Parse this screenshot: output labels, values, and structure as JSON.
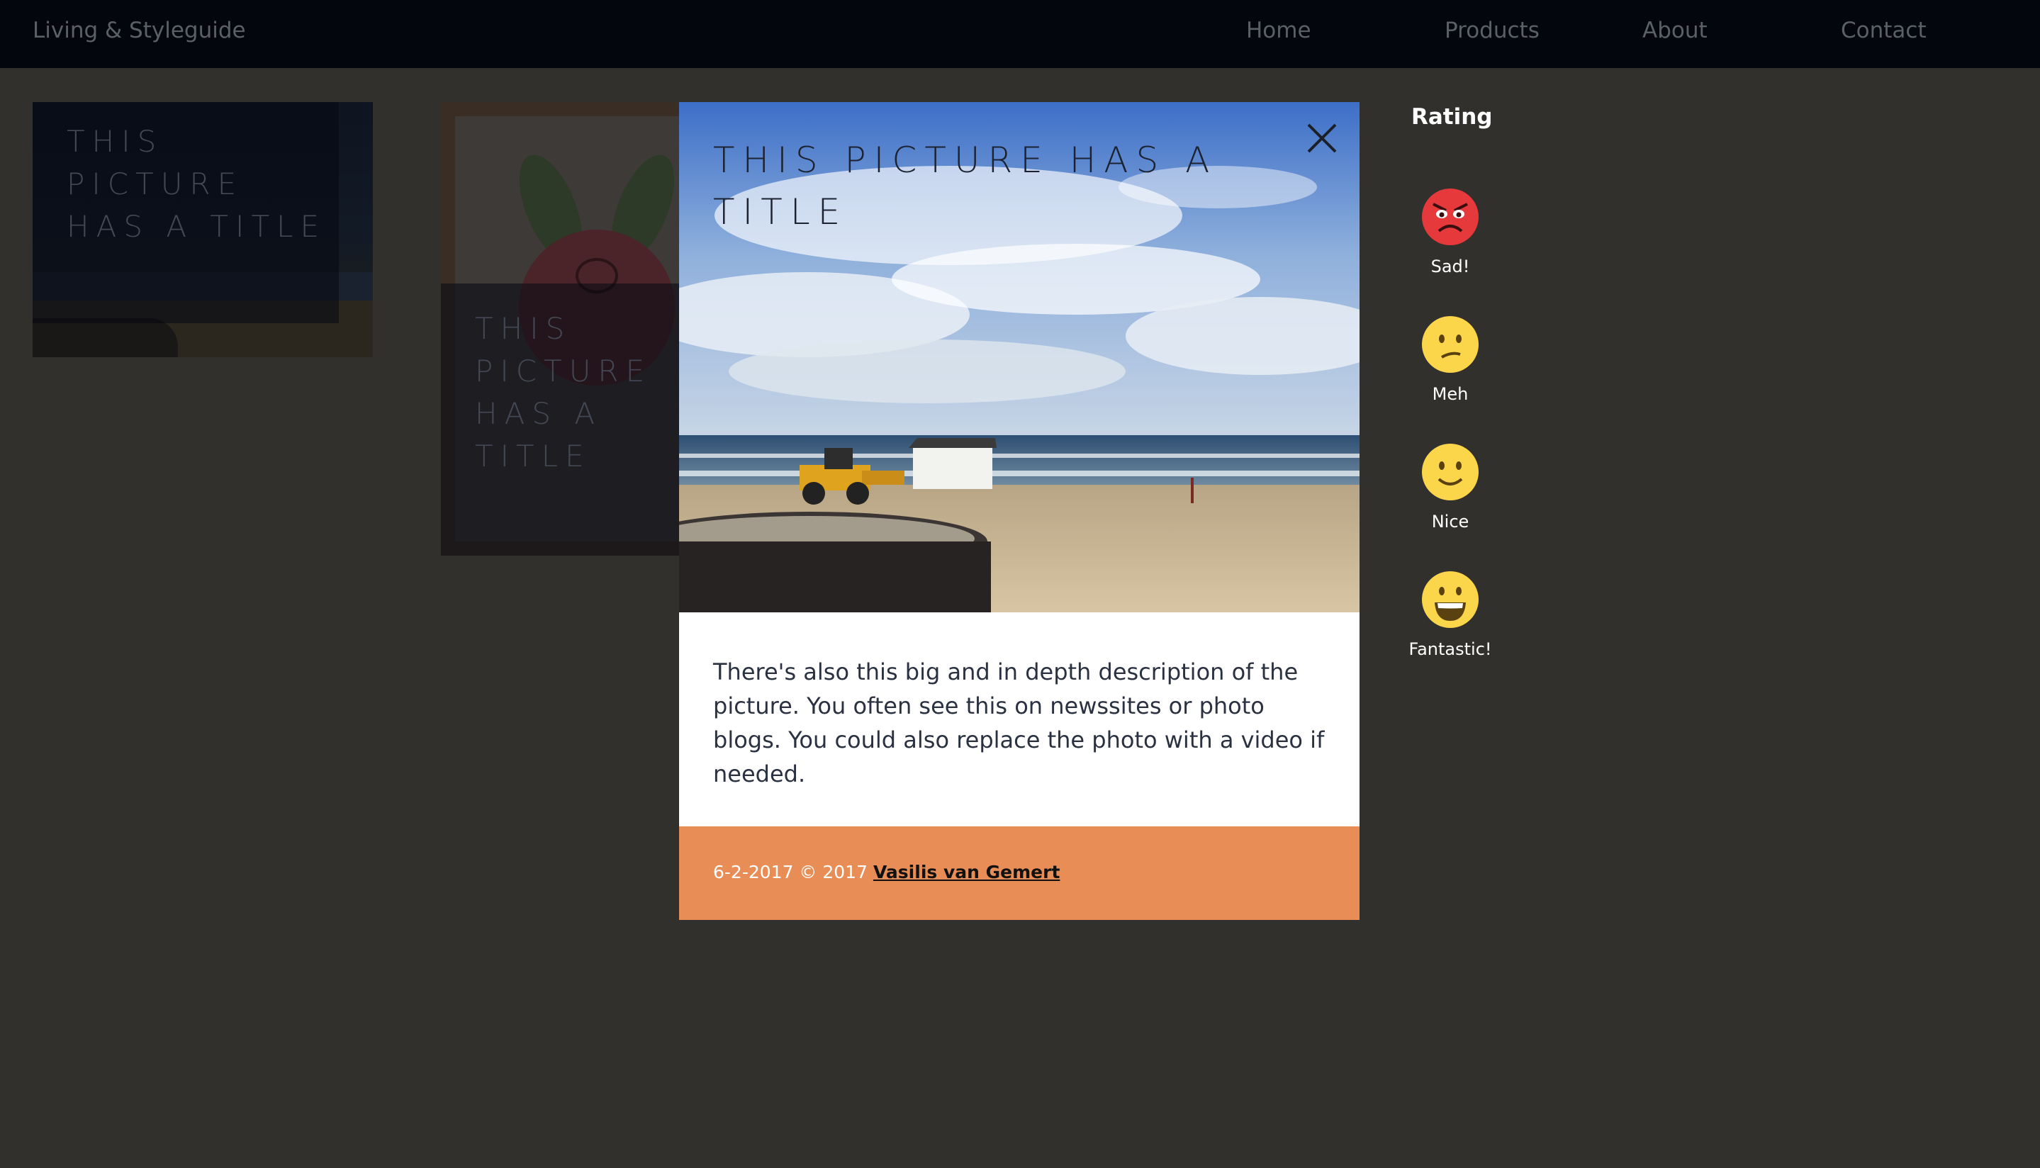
{
  "header": {
    "brand": "Living & Styleguide",
    "nav": [
      {
        "label": "Home"
      },
      {
        "label": "Products"
      },
      {
        "label": "About"
      },
      {
        "label": "Contact"
      }
    ]
  },
  "gallery": {
    "items": [
      {
        "title": "THIS PICTURE HAS A TITLE"
      },
      {
        "title": "THIS PICTURE HAS A TITLE"
      }
    ]
  },
  "modal": {
    "title": "THIS PICTURE HAS A TITLE",
    "description": "There's also this big and in depth description of the picture. You often see this on newssites or photo blogs. You could also replace the photo with a video if needed.",
    "footer": {
      "date_copyright": "6-2-2017 © 2017",
      "author": "Vasilis van Gemert"
    }
  },
  "rating": {
    "heading": "Rating",
    "options": [
      {
        "label": "Sad!",
        "icon": "angry-face-icon",
        "color": "#e5393c"
      },
      {
        "label": "Meh",
        "icon": "confused-face-icon",
        "color": "#fbd64a"
      },
      {
        "label": "Nice",
        "icon": "smiling-face-icon",
        "color": "#fbd64a"
      },
      {
        "label": "Fantastic!",
        "icon": "grinning-face-icon",
        "color": "#fbd64a"
      }
    ]
  },
  "colors": {
    "nav_background": "#03060c",
    "page_background": "#31302c",
    "modal_footer": "#e98d57"
  }
}
